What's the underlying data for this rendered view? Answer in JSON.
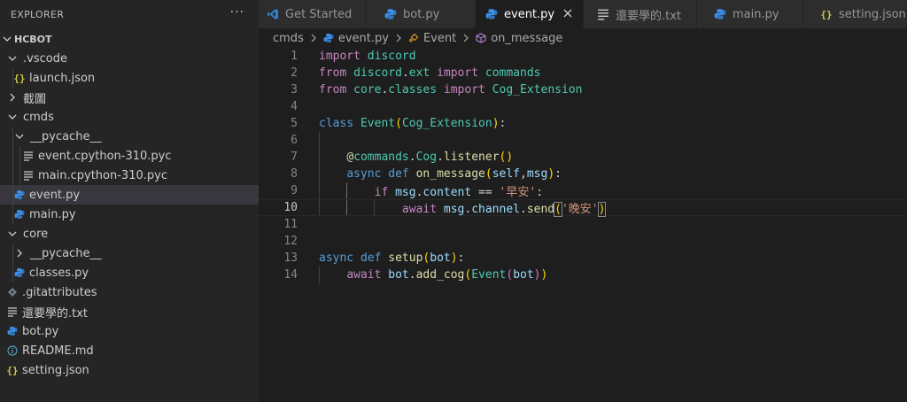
{
  "explorer": {
    "title": "EXPLORER",
    "more": "···",
    "tree": [
      {
        "label": "HCBOT",
        "kind": "root"
      },
      {
        "label": ".vscode",
        "kind": "folder-open"
      },
      {
        "label": "launch.json",
        "kind": "json"
      },
      {
        "label": "截圖",
        "kind": "folder-closed"
      },
      {
        "label": "cmds",
        "kind": "folder-open"
      },
      {
        "label": "__pycache__",
        "kind": "folder-open"
      },
      {
        "label": "event.cpython-310.pyc",
        "kind": "lines"
      },
      {
        "label": "main.cpython-310.pyc",
        "kind": "lines"
      },
      {
        "label": "event.py",
        "kind": "python"
      },
      {
        "label": "main.py",
        "kind": "python"
      },
      {
        "label": "core",
        "kind": "folder-open"
      },
      {
        "label": "__pycache__",
        "kind": "folder-closed"
      },
      {
        "label": "classes.py",
        "kind": "python"
      },
      {
        "label": ".gitattributes",
        "kind": "git"
      },
      {
        "label": "還要學的.txt",
        "kind": "lines"
      },
      {
        "label": "bot.py",
        "kind": "python"
      },
      {
        "label": "README.md",
        "kind": "info"
      },
      {
        "label": "setting.json",
        "kind": "json"
      }
    ]
  },
  "tabs": [
    {
      "label": "Get Started",
      "icon": "vscode-icon"
    },
    {
      "label": "bot.py",
      "icon": "python-icon"
    },
    {
      "label": "event.py",
      "icon": "python-icon",
      "active": true
    },
    {
      "label": "還要學的.txt",
      "icon": "lines-icon"
    },
    {
      "label": "main.py",
      "icon": "python-icon"
    },
    {
      "label": "setting.json",
      "icon": "json-icon"
    }
  ],
  "breadcrumb": {
    "folder": "cmds",
    "file": "event.py",
    "class": "Event",
    "method": "on_message"
  },
  "editor": {
    "current_line": 10,
    "line_numbers": [
      "1",
      "2",
      "3",
      "4",
      "5",
      "6",
      "7",
      "8",
      "9",
      "10",
      "11",
      "12",
      "13",
      "14"
    ]
  },
  "colors": {
    "keyword": "#569cd6",
    "control": "#c586c0",
    "class": "#4ec9b0",
    "function": "#dcdcaa",
    "variable": "#9cdcfe",
    "string": "#ce9178",
    "python_icon": "#3b8eea",
    "json_icon": "#cbcb41"
  }
}
